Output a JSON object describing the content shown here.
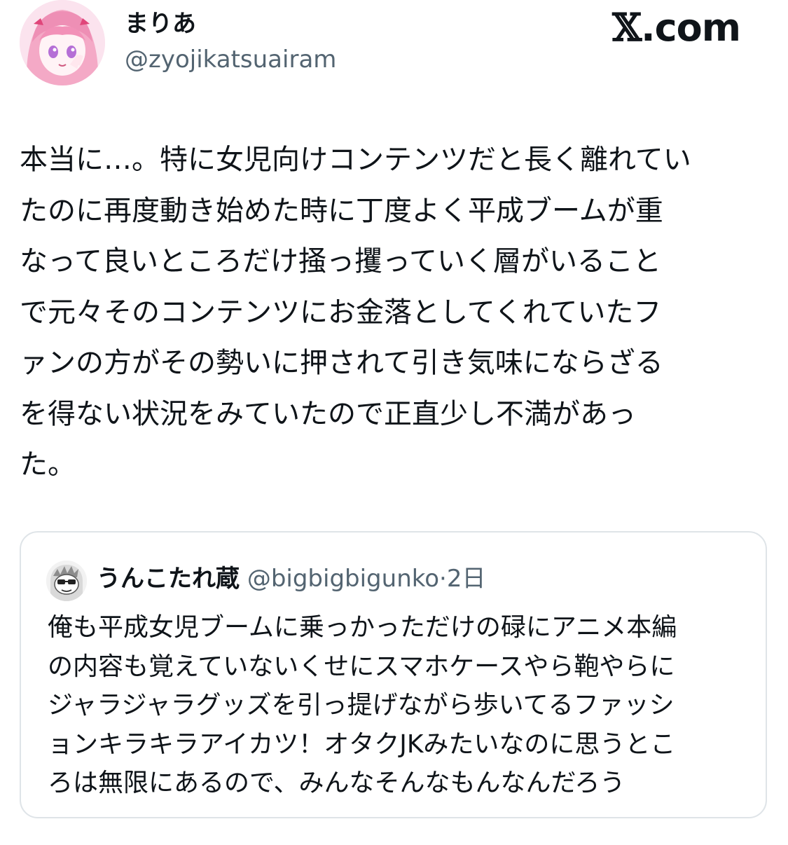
{
  "author": {
    "display_name": "まりあ",
    "handle": "@zyojikatsuairam",
    "avatar_icon": "anime-girl-avatar-icon"
  },
  "brand": {
    "x_glyph": "𝕏",
    "suffix": ".com"
  },
  "tweet": {
    "lines": [
      "本当に…。特に女児向けコンテンツだと長く離れてい",
      "たのに再度動き始めた時に丁度よく平成ブームが重",
      "なって良いところだけ掻っ攫っていく層がいること",
      "で元々そのコンテンツにお金落としてくれていたフ",
      "ァンの方がその勢いに押されて引き気味にならざる",
      "を得ない状況をみていたので正直少し不満があっ",
      "た。"
    ]
  },
  "quote": {
    "display_name": "うんこたれ蔵",
    "handle": "@bigbigbigunko",
    "separator": "·",
    "time": "2日",
    "avatar_icon": "manga-character-avatar-icon",
    "lines": [
      "俺も平成女児ブームに乗っかっただけの碌にアニメ本編",
      "の内容も覚えていないくせにスマホケースやら鞄やらに",
      "ジャラジャラグッズを引っ提げながら歩いてるファッシ",
      "ョンキラキラアイカツ！オタクJKみたいなのに思うとこ",
      "ろは無限にあるので、みんなそんなもんなんだろう"
    ]
  },
  "colors": {
    "text_primary": "#0f1419",
    "text_secondary": "#536471",
    "card_border": "#dfe4e8",
    "avatar_bg": "#fbe3ee"
  }
}
